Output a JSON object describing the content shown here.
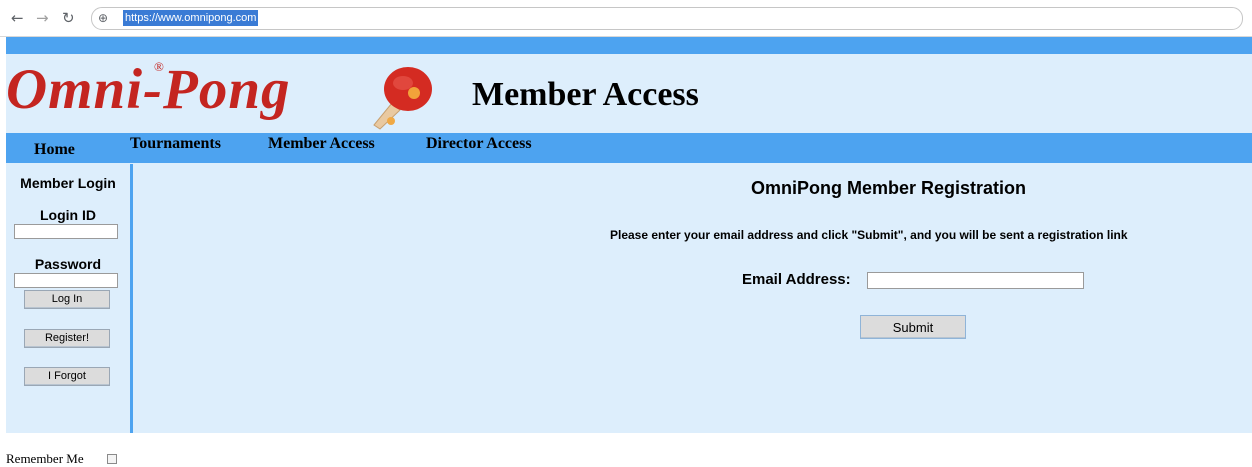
{
  "browser": {
    "back_icon": "back-arrow-icon",
    "forward_icon": "forward-arrow-icon",
    "reload_icon": "reload-icon",
    "url": "https://www.omnipong.com"
  },
  "header": {
    "brand": "Omni-Pong",
    "registered_mark": "®",
    "section_title": "Member Access"
  },
  "nav": {
    "items": [
      {
        "label": "Home"
      },
      {
        "label": "Tournaments"
      },
      {
        "label": "Member Access"
      },
      {
        "label": "Director Access"
      }
    ]
  },
  "sidebar": {
    "title": "Member Login",
    "login_id_label": "Login ID",
    "password_label": "Password",
    "login_button": "Log In",
    "register_button": "Register!",
    "forgot_button": "I Forgot",
    "remember_label": "Remember Me"
  },
  "main": {
    "title": "OmniPong Member Registration",
    "instructions": "Please enter your email address and click \"Submit\", and you will be sent a registration link",
    "email_label": "Email Address:",
    "email_value": "",
    "submit_label": "Submit"
  },
  "colors": {
    "brand_red": "#c42520",
    "nav_blue": "#4da3f0",
    "page_background": "#ddeefc"
  }
}
